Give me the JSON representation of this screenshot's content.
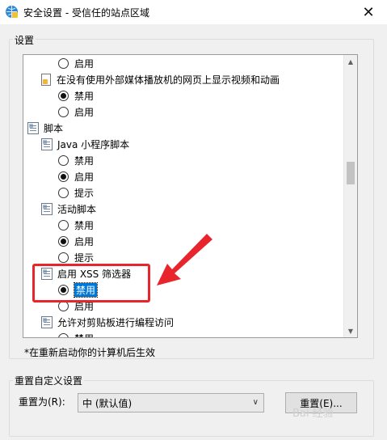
{
  "window": {
    "title": "安全设置 - 受信任的站点区域",
    "close_glyph": "✕",
    "app_icon": "shield-globe-icon"
  },
  "settings": {
    "group_label": "设置",
    "rows": [
      {
        "kind": "radio",
        "label": "启用",
        "checked": false
      },
      {
        "kind": "page",
        "label": "在没有使用外部媒体播放机的网页上显示视频和动画"
      },
      {
        "kind": "radio",
        "label": "禁用",
        "checked": true
      },
      {
        "kind": "radio",
        "label": "启用",
        "checked": false
      },
      {
        "kind": "category",
        "label": "脚本"
      },
      {
        "kind": "setting",
        "label": "Java 小程序脚本"
      },
      {
        "kind": "radio",
        "label": "禁用",
        "checked": false
      },
      {
        "kind": "radio",
        "label": "启用",
        "checked": true
      },
      {
        "kind": "radio",
        "label": "提示",
        "checked": false
      },
      {
        "kind": "setting",
        "label": "活动脚本"
      },
      {
        "kind": "radio",
        "label": "禁用",
        "checked": false
      },
      {
        "kind": "radio",
        "label": "启用",
        "checked": true
      },
      {
        "kind": "radio",
        "label": "提示",
        "checked": false
      },
      {
        "kind": "setting",
        "label": "启用 XSS 筛选器"
      },
      {
        "kind": "radio",
        "label": "禁用",
        "checked": true,
        "selected": true
      },
      {
        "kind": "radio",
        "label": "启用",
        "checked": false
      },
      {
        "kind": "setting",
        "label": "允许对剪贴板进行编程访问"
      },
      {
        "kind": "radio",
        "label": "禁用",
        "checked": false
      }
    ]
  },
  "note": "*在重新启动你的计算机后生效",
  "reset": {
    "group_label": "重置自定义设置",
    "reset_to_label": "重置为(R):",
    "dropdown_value": "中 (默认值)",
    "button_label": "重置(E)...",
    "watermark": "Bai 经验"
  },
  "annotation": {
    "highlight_color": "#e8252c"
  }
}
